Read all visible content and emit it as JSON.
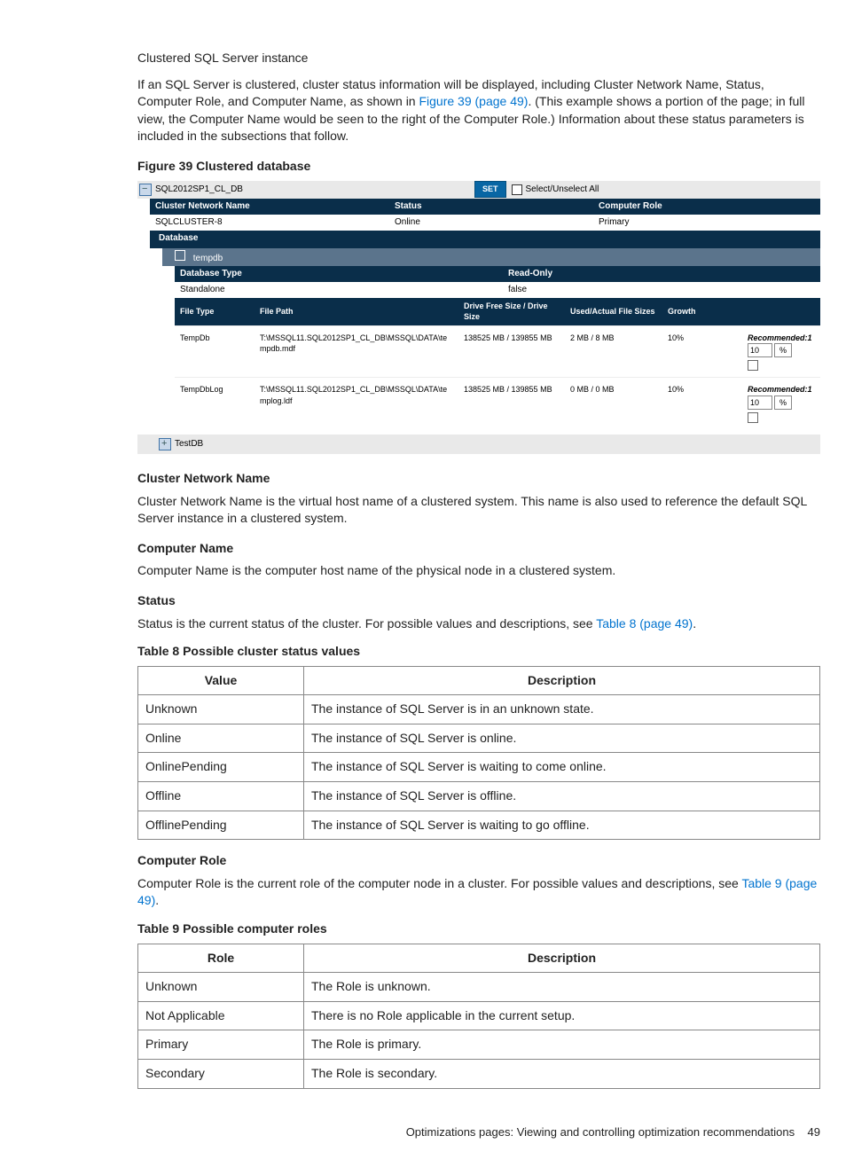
{
  "intro": {
    "heading": "Clustered SQL Server instance",
    "para1a": "If an SQL Server is clustered, cluster status information will be displayed, including Cluster Network Name, Status, Computer Role, and Computer Name, as shown in ",
    "para1_link": "Figure 39 (page 49)",
    "para1b": ". (This example shows a portion of the page; in full view, the Computer Name would be seen to the right of the Computer Role.) Information about these status parameters is included in the subsections that follow."
  },
  "figure39": {
    "title": "Figure 39 Clustered database",
    "db_title": "SQL2012SP1_CL_DB",
    "set_btn": "SET",
    "select_all": "Select/Unselect All",
    "hdr_cnn": "Cluster Network Name",
    "hdr_status": "Status",
    "hdr_cr": "Computer Role",
    "val_cnn": "SQLCLUSTER-8",
    "val_status": "Online",
    "val_cr": "Primary",
    "database_label": "Database",
    "tempdb_label": "tempdb",
    "hdr_dbtype": "Database Type",
    "hdr_readonly": "Read-Only",
    "val_dbtype": "Standalone",
    "val_readonly": "false",
    "fh_type": "File Type",
    "fh_path": "File Path",
    "fh_drive": "Drive Free Size / Drive Size",
    "fh_used": "Used/Actual File Sizes",
    "fh_growth": "Growth",
    "file_rows": [
      {
        "type": "TempDb",
        "path": "T:\\MSSQL11.SQL2012SP1_CL_DB\\MSSQL\\DATA\\tempdb.mdf",
        "drive": "138525 MB / 139855 MB",
        "used": "2 MB / 8 MB",
        "growth": "10%",
        "reco_label": "Recommended:1",
        "reco_val": "10",
        "reco_pct": "%"
      },
      {
        "type": "TempDbLog",
        "path": "T:\\MSSQL11.SQL2012SP1_CL_DB\\MSSQL\\DATA\\templog.ldf",
        "drive": "138525 MB / 139855 MB",
        "used": "0 MB / 0 MB",
        "growth": "10%",
        "reco_label": "Recommended:1",
        "reco_val": "10",
        "reco_pct": "%"
      }
    ],
    "testdb_label": "TestDB"
  },
  "sections": {
    "cnn_h": "Cluster Network Name",
    "cnn_p": "Cluster Network Name is the virtual host name of a clustered system. This name is also used to reference the default SQL Server instance in a clustered system.",
    "cn_h": "Computer Name",
    "cn_p": "Computer Name is the computer host name of the physical node in a clustered system.",
    "st_h": "Status",
    "st_p_a": "Status is the current status of the cluster. For possible values and descriptions, see ",
    "st_link": "Table 8 (page 49)",
    "st_p_b": ".",
    "cr_h": "Computer Role",
    "cr_p_a": "Computer Role is the current role of the computer node in a cluster. For possible values and descriptions, see ",
    "cr_link": "Table 9 (page 49)",
    "cr_p_b": "."
  },
  "table8": {
    "title": "Table 8 Possible cluster status values",
    "col1": "Value",
    "col2": "Description",
    "rows": [
      {
        "v": "Unknown",
        "d": "The instance of SQL Server is in an unknown state."
      },
      {
        "v": "Online",
        "d": "The instance of SQL Server is online."
      },
      {
        "v": "OnlinePending",
        "d": "The instance of SQL Server is waiting to come online."
      },
      {
        "v": "Offline",
        "d": "The instance of SQL Server is offline."
      },
      {
        "v": "OfflinePending",
        "d": "The instance of SQL Server is waiting to go offline."
      }
    ]
  },
  "table9": {
    "title": "Table 9 Possible computer roles",
    "col1": "Role",
    "col2": "Description",
    "rows": [
      {
        "v": "Unknown",
        "d": "The Role is unknown."
      },
      {
        "v": "Not Applicable",
        "d": "There is no Role applicable in the current setup."
      },
      {
        "v": "Primary",
        "d": "The Role is primary."
      },
      {
        "v": "Secondary",
        "d": "The Role is secondary."
      }
    ]
  },
  "footer": {
    "text": "Optimizations pages: Viewing and controlling optimization recommendations",
    "page": "49"
  }
}
